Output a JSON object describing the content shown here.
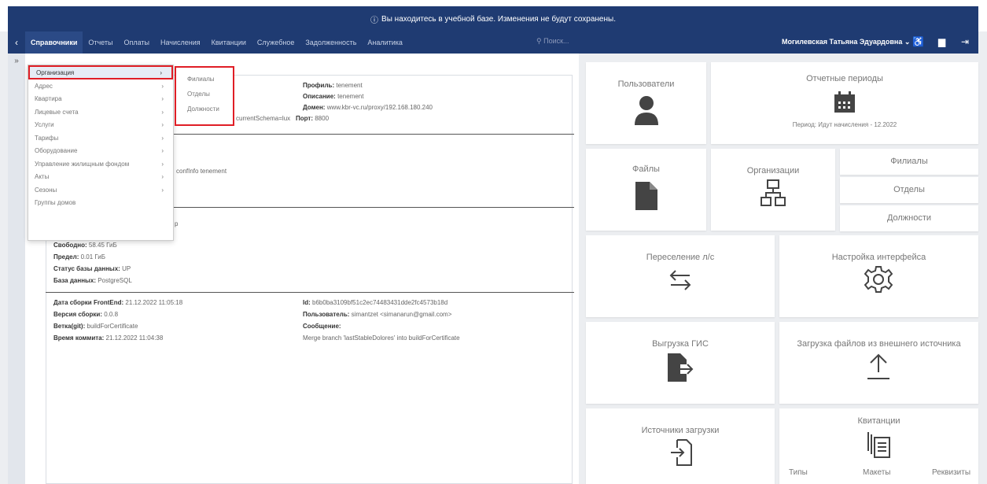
{
  "banner": {
    "icon": "info-icon",
    "text": "Вы находитесь в учебной базе. Изменения не будут сохранены."
  },
  "nav": {
    "items": [
      "Справочники",
      "Отчеты",
      "Оплаты",
      "Начисления",
      "Квитанции",
      "Служебное",
      "Задолженность",
      "Аналитика"
    ],
    "search_placeholder": "Поиск...",
    "user": "Могилевская Татьяна Эдуардовна"
  },
  "dropdown": {
    "items": [
      "Организация",
      "Адрес",
      "Квартира",
      "Лицевые счета",
      "Услуги",
      "Тарифы",
      "Оборудование",
      "Управление жилищным фондом",
      "Акты",
      "Сезоны",
      "Группы домов"
    ],
    "submenu": [
      "Филиалы",
      "Отделы",
      "Должности"
    ]
  },
  "info": {
    "profile_label": "Профиль:",
    "profile_value": "tenement",
    "description_label": "Описание:",
    "description_value": "tenement",
    "domain_label": "Домен:",
    "domain_value": "www.kbr-vc.ru/proxy/192.168.180.240",
    "port_label": "Порт:",
    "port_value": "8800",
    "schema_fragment": "currentSchema=lux",
    "conf_fragment": "confInfo tenement",
    "p_fragment": "p",
    "free_label": "Свободно:",
    "free_value": "58.45 ГиБ",
    "limit_label": "Предел:",
    "limit_value": "0.01 ГиБ",
    "db_status_label": "Статус базы данных:",
    "db_status_value": "UP",
    "db_label": "База данных:",
    "db_value": "PostgreSQL",
    "build_date_label": "Дата сборки FrontEnd:",
    "build_date_value": "21.12.2022 11:05:18",
    "version_label": "Версия сборки:",
    "version_value": "0.0.8",
    "branch_label": "Ветка(git):",
    "branch_value": "buildForCertificate",
    "commit_time_label": "Время коммита:",
    "commit_time_value": "21.12.2022 11:04:38",
    "id_label": "Id:",
    "id_value": "b6b0ba3109bf51c2ec74483431dde2fc4573b18d",
    "user_label": "Пользователь:",
    "user_value": "simantzet <simanarun@gmail.com>",
    "message_label": "Сообщение:",
    "message_value": "Merge branch 'lastStableDolores' into buildForCertificate"
  },
  "tiles": {
    "users": "Пользователи",
    "periods": "Отчетные периоды",
    "period_text": "Период: Идут начисления - 12.2022",
    "files": "Файлы",
    "orgs": "Организации",
    "branches": "Филиалы",
    "departments": "Отделы",
    "positions": "Должности",
    "resettle": "Переселение л/с",
    "interface": "Настройка интерфейса",
    "gis": "Выгрузка ГИС",
    "external": "Загрузка файлов из внешнего источника",
    "sources": "Источники загрузки",
    "receipts": "Квитанции",
    "types": "Типы",
    "layouts": "Макеты",
    "requisites": "Реквизиты"
  }
}
